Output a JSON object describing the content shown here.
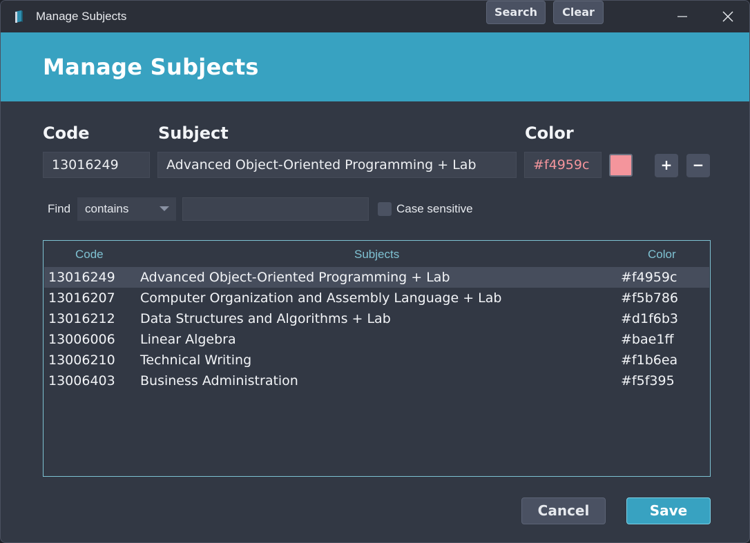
{
  "window": {
    "title": "Manage Subjects"
  },
  "header": {
    "title": "Manage Subjects"
  },
  "form": {
    "code_label": "Code",
    "subject_label": "Subject",
    "color_label": "Color",
    "code_value": "13016249",
    "subject_value": "Advanced Object-Oriented Programming + Lab",
    "color_value": "#f4959c",
    "swatch_color": "#f4959c",
    "add_label": "+",
    "remove_label": "−"
  },
  "find": {
    "label": "Find",
    "mode": "contains",
    "query": "",
    "case_sensitive_label": "Case sensitive",
    "case_sensitive": false,
    "search_label": "Search",
    "clear_label": "Clear"
  },
  "table": {
    "headers": {
      "code": "Code",
      "subject": "Subjects",
      "color": "Color"
    },
    "rows": [
      {
        "code": "13016249",
        "subject": "Advanced Object-Oriented Programming + Lab",
        "color": "#f4959c"
      },
      {
        "code": "13016207",
        "subject": "Computer Organization and Assembly Language + Lab",
        "color": "#f5b786"
      },
      {
        "code": "13016212",
        "subject": "Data Structures and Algorithms + Lab",
        "color": "#d1f6b3"
      },
      {
        "code": "13006006",
        "subject": "Linear Algebra",
        "color": "#bae1ff"
      },
      {
        "code": "13006210",
        "subject": "Technical Writing",
        "color": "#f1b6ea"
      },
      {
        "code": "13006403",
        "subject": "Business Administration",
        "color": "#f5f395"
      }
    ],
    "selected_index": 0
  },
  "footer": {
    "cancel_label": "Cancel",
    "save_label": "Save"
  },
  "theme": {
    "accent": "#38a2c1",
    "background": "#323844",
    "titlebar": "#2b2f38"
  }
}
